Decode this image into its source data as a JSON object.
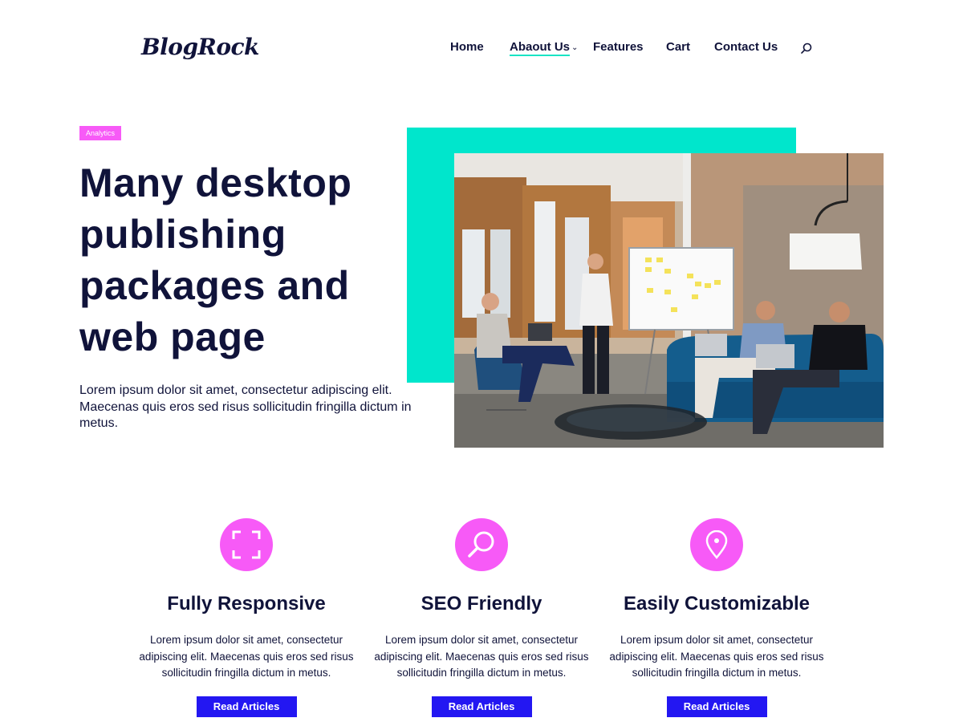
{
  "header": {
    "logo": "BlogRock",
    "nav": [
      "Home",
      "Abaout Us",
      "Features",
      "Cart",
      "Contact Us"
    ]
  },
  "hero": {
    "badge": "Analytics",
    "title": "Many desktop publishing packages and web page",
    "text": "Lorem ipsum dolor sit amet, consectetur adipiscing elit. Maecenas quis eros sed risus sollicitudin fringilla dictum in metus."
  },
  "features": [
    {
      "icon": "expand-icon",
      "title": "Fully Responsive",
      "text": "Lorem ipsum dolor sit amet, consectetur adipiscing elit. Maecenas quis eros sed risus sollicitudin fringilla dictum in metus.",
      "button": "Read Articles"
    },
    {
      "icon": "search-icon",
      "title": "SEO Friendly",
      "text": "Lorem ipsum dolor sit amet, consectetur adipiscing elit. Maecenas quis eros sed risus sollicitudin fringilla dictum in metus.",
      "button": "Read Articles"
    },
    {
      "icon": "location-pin-icon",
      "title": "Easily Customizable",
      "text": "Lorem ipsum dolor sit amet, consectetur adipiscing elit. Maecenas quis eros sed risus sollicitudin fringilla dictum in metus.",
      "button": "Read Articles"
    }
  ],
  "colors": {
    "navy": "#10133a",
    "pink": "#f75af7",
    "teal": "#00e6cc",
    "button_blue": "#2317f2"
  }
}
